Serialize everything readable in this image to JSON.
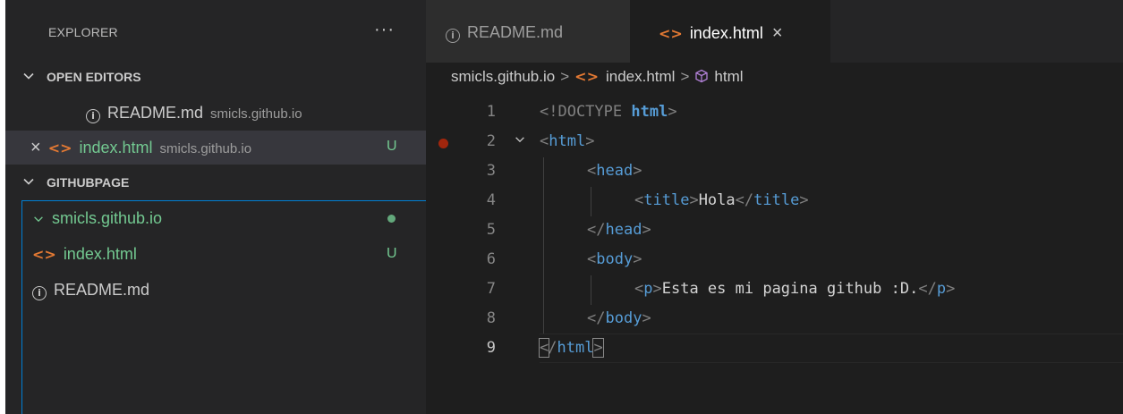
{
  "sidebar": {
    "title": "EXPLORER",
    "more": "···",
    "open_editors": {
      "label": "OPEN EDITORS",
      "items": [
        {
          "name": "README.md",
          "desc": "smicls.github.io",
          "icon": "info-icon"
        },
        {
          "name": "index.html",
          "desc": "smicls.github.io",
          "icon": "code-icon",
          "close": "×",
          "badge": "U"
        }
      ]
    },
    "workspace": {
      "label": "GITHUBPAGE",
      "folder": "smicls.github.io",
      "files": [
        {
          "name": "index.html",
          "badge": "U",
          "icon": "code-icon"
        },
        {
          "name": "README.md",
          "icon": "info-icon"
        }
      ]
    }
  },
  "tabs": [
    {
      "label": "README.md",
      "icon": "info-icon",
      "active": false
    },
    {
      "label": "index.html",
      "icon": "code-icon",
      "active": true,
      "close": "×"
    }
  ],
  "breadcrumb": {
    "folder": "smicls.github.io",
    "file": "index.html",
    "symbol": "html",
    "sep": ">"
  },
  "code": {
    "line_numbers": [
      "1",
      "2",
      "3",
      "4",
      "5",
      "6",
      "7",
      "8",
      "9"
    ],
    "doctype_open": "<!DOCTYPE ",
    "doctype_kw": "html",
    "doctype_close": ">",
    "open_br": "<",
    "close_br": ">",
    "end_open_br": "</",
    "tag_html": "html",
    "tag_head": "head",
    "tag_title": "title",
    "tag_body": "body",
    "tag_p": "p",
    "title_text": "Hola",
    "p_text": "Esta es mi pagina github :D."
  },
  "colors": {
    "accent": "#007fd4",
    "untracked": "#73c991",
    "html_icon": "#e37933",
    "breakpoint": "#a1260d"
  }
}
